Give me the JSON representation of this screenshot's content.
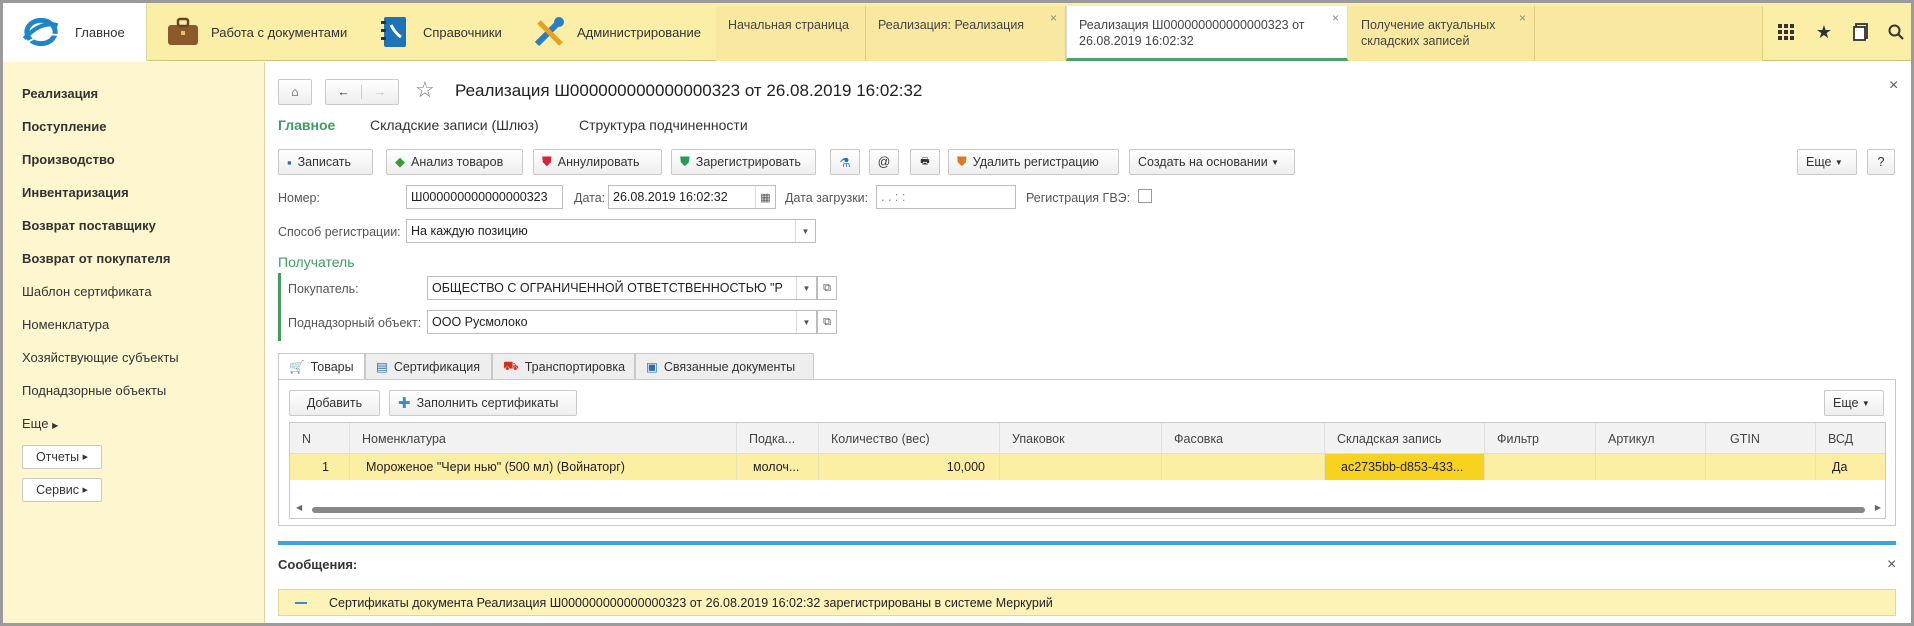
{
  "topbar": {
    "sections": [
      {
        "label": "Главное",
        "icon": "home-logo-icon"
      },
      {
        "label": "Работа с документами",
        "icon": "briefcase-icon"
      },
      {
        "label": "Справочники",
        "icon": "phonebook-icon"
      },
      {
        "label": "Администрирование",
        "icon": "tools-icon"
      }
    ],
    "tabs": [
      {
        "label": "Начальная страница"
      },
      {
        "label": "Реализация: Реализация"
      },
      {
        "label": "Реализация Ш000000000000000323 от 26.08.2019 16:02:32"
      },
      {
        "label": "Получение актуальных складских записей"
      }
    ],
    "tab_close": "×",
    "icons": [
      "apps-grid-icon",
      "star-icon",
      "history-icon",
      "search-icon"
    ]
  },
  "sidebar": {
    "items": [
      {
        "label": "Реализация"
      },
      {
        "label": "Поступление"
      },
      {
        "label": "Производство"
      },
      {
        "label": "Инвентаризация"
      },
      {
        "label": "Возврат поставщику"
      },
      {
        "label": "Возврат от покупателя"
      },
      {
        "label": "Шаблон сертификата"
      },
      {
        "label": "Номенклатура"
      },
      {
        "label": "Хозяйствующие субъекты"
      },
      {
        "label": "Поднадзорные объекты"
      },
      {
        "label": "Еще"
      }
    ],
    "buttons": [
      {
        "label": "Отчеты"
      },
      {
        "label": "Сервис"
      }
    ]
  },
  "form": {
    "title": "Реализация Ш000000000000000323 от 26.08.2019 16:02:32",
    "close": "×",
    "subnav": [
      "Главное",
      "Складские записи (Шлюз)",
      "Структура подчиненности"
    ],
    "toolbar": {
      "save": "Записать",
      "analyze": "Анализ товаров",
      "cancel": "Аннулировать",
      "register": "Зарегистрировать",
      "delete_reg": "Удалить регистрацию",
      "create_based": "Создать на основании",
      "more": "Еще",
      "help": "?"
    },
    "fields": {
      "number_label": "Номер:",
      "number_value": "Ш000000000000000323",
      "date_label": "Дата:",
      "date_value": "26.08.2019 16:02:32",
      "load_date_label": "Дата загрузки:",
      "load_date_value": " .  .       :  :",
      "gvz_label": "Регистрация ГВЭ:",
      "reg_method_label": "Способ регистрации:",
      "reg_method_value": "На каждую позицию",
      "recipient_group": "Получатель",
      "buyer_label": "Покупатель:",
      "buyer_value": "ОБЩЕСТВО С ОГРАНИЧЕННОЙ ОТВЕТСТВЕННОСТЬЮ \"Р",
      "object_label": "Поднадзорный объект:",
      "object_value": "ООО Русмолоко"
    },
    "tabs": [
      "Товары",
      "Сертификация",
      "Транспортировка",
      "Связанные документы"
    ],
    "table_toolbar": {
      "add": "Добавить",
      "fill": "Заполнить сертификаты",
      "more": "Еще"
    },
    "table": {
      "columns": [
        "N",
        "Номенклатура",
        "Подка...",
        "Количество (вес)",
        "Упаковок",
        "Фасовка",
        "Складская запись",
        "Фильтр",
        "Артикул",
        "GTIN",
        "ВСД"
      ],
      "rows": [
        [
          "1",
          "Мороженое \"Чери нью\" (500 мл) (Войнаторг)",
          "молоч...",
          "10,000",
          "",
          "",
          "ac2735bb-d853-433...",
          "",
          "",
          "",
          "Да"
        ]
      ]
    },
    "messages": {
      "title": "Сообщения:",
      "close": "×",
      "items": [
        {
          "text": "Сертификаты документа Реализация Ш000000000000000323 от 26.08.2019 16:02:32 зарегистрированы в системе Меркурий"
        }
      ]
    }
  },
  "colors": {
    "accent_green": "#3e9e5e",
    "topbar": "#fbeea6",
    "sidebar": "#fdf6cf",
    "row_selected": "#fcefa3",
    "cell_active": "#f7d21e",
    "message_bar": "#fdf3b8",
    "separator_blue": "#37a6de"
  }
}
